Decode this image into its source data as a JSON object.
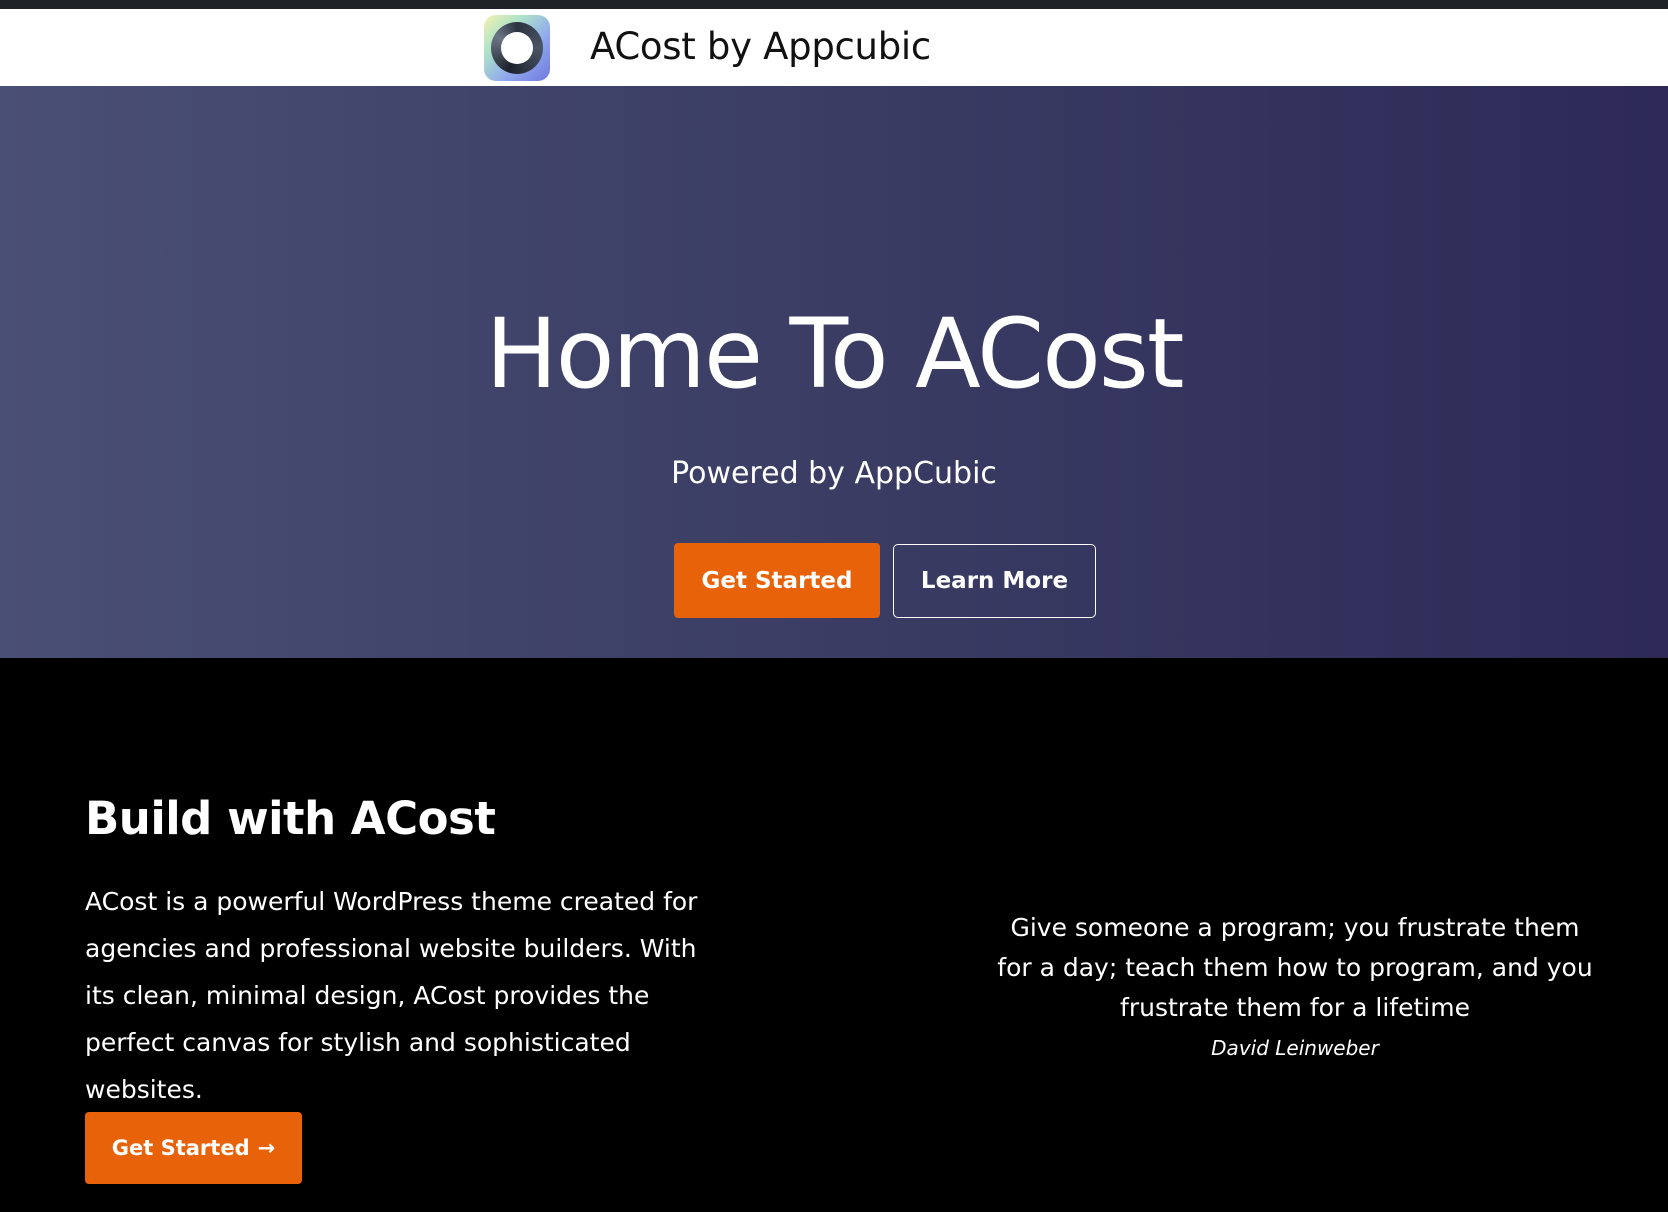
{
  "header": {
    "logo_icon": "appcubic-ring-logo",
    "site_title": "ACost by Appcubic"
  },
  "hero": {
    "title": "Home To ACost",
    "subtitle": "Powered by AppCubic",
    "primary_button": "Get Started",
    "secondary_button": "Learn More"
  },
  "build": {
    "title": "Build with ACost",
    "description": "ACost is a powerful WordPress theme created for agencies and professional website builders. With its clean, minimal design, ACost provides the perfect canvas for stylish and sophisticated websites.",
    "cta_label": "Get Started",
    "cta_arrow": "→"
  },
  "quote": {
    "text": "Give someone a program; you frustrate them for a day; teach them how to program, and you frustrate them for a lifetime",
    "author": "David Leinweber"
  },
  "colors": {
    "accent": "#e8620a",
    "hero_gradient_start": "#4a4f75",
    "hero_gradient_end": "#2e2957",
    "header_bg": "#ffffff",
    "page_bg": "#000000"
  }
}
